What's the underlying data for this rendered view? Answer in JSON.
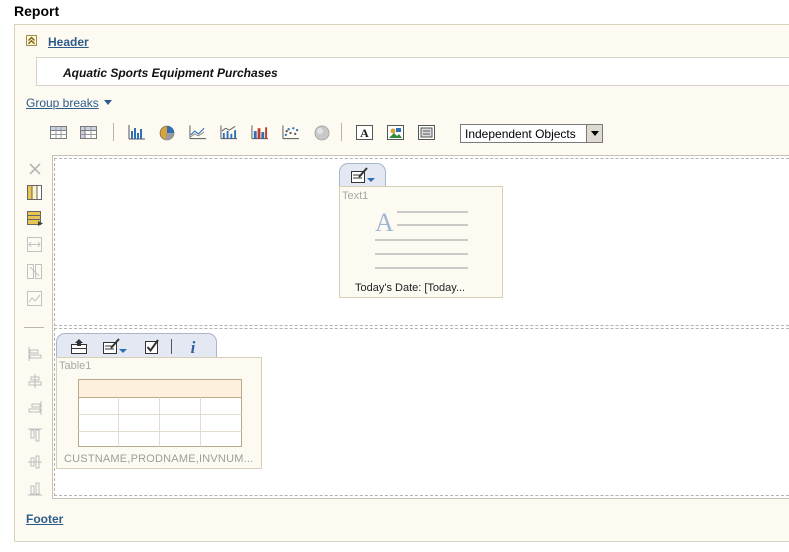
{
  "window": {
    "title": "Report"
  },
  "header": {
    "label": "Header",
    "text": "Aquatic Sports Equipment Purchases"
  },
  "group_breaks": {
    "label": "Group breaks"
  },
  "toolbar": {
    "icons": [
      "table-icon",
      "crosstab-icon",
      "bar-chart-icon",
      "pie-chart-icon",
      "line-chart-icon",
      "bar-line-chart-icon",
      "vertical-bar-icon",
      "scatter-plot-icon",
      "gauge-icon",
      "text-object-icon",
      "image-object-icon",
      "graphic-object-icon"
    ],
    "layout_select": {
      "value": "Independent Objects"
    }
  },
  "side_toolbar": {
    "icons": [
      "delete-icon",
      "columns-icon",
      "table-props-icon",
      "spread-icon",
      "split-icon",
      "chart-icon",
      "align-left-icon",
      "align-center-icon",
      "align-right-icon",
      "align-top-icon",
      "align-middle-icon",
      "align-bottom-icon"
    ]
  },
  "text_object": {
    "name": "Text1",
    "caption": "Today's Date: [Today..."
  },
  "table_object": {
    "name": "Table1",
    "caption": "CUSTNAME,PRODNAME,INVNUM..."
  },
  "footer": {
    "label": "Footer"
  },
  "colors": {
    "link": "#2d5c8b",
    "panel_bg": "#fdfaf2",
    "tab_bg": "#e3e8f2"
  }
}
